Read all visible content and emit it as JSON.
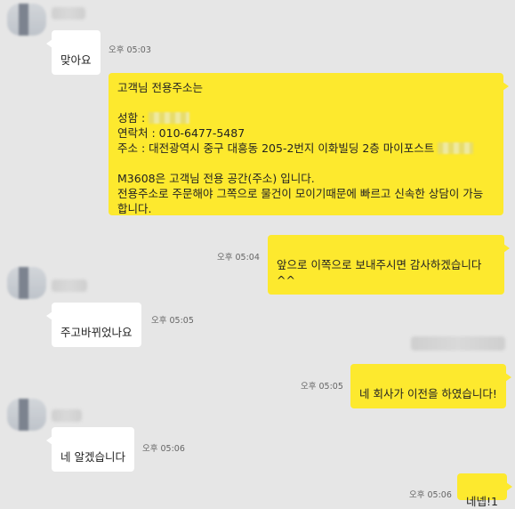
{
  "chat": {
    "messages": [
      {
        "id": "m1",
        "text": "맞아요",
        "time": "오후 05:03"
      },
      {
        "id": "m2",
        "lines": [
          "고객님 전용주소는",
          "",
          "성함 :",
          "연락처 : 010-6477-5487",
          "주소 : 대전광역시 중구 대흥동 205-2번지 이화빌딩 2층 마이포스트",
          "",
          "M3608은 고객님 전용 공간(주소) 입니다.",
          "전용주소로 주문해야 그쪽으로 물건이 모이기때문에 빠르고 신속한 상담이 가능",
          "합니다."
        ]
      },
      {
        "id": "m3",
        "text": "앞으로 이쪽으로 보내주시면 감사하겠습니다^^",
        "time": "오후 05:04"
      },
      {
        "id": "m4",
        "text": "주고바뀌었나요",
        "time": "오후 05:05"
      },
      {
        "id": "m5",
        "text": "네 회사가 이전을 하였습니다!",
        "time": "오후 05:05"
      },
      {
        "id": "m6",
        "text": "네 알겠습니다",
        "time": "오후 05:06"
      },
      {
        "id": "m7",
        "text": "네넵!1",
        "time": "오후 05:06"
      }
    ]
  }
}
